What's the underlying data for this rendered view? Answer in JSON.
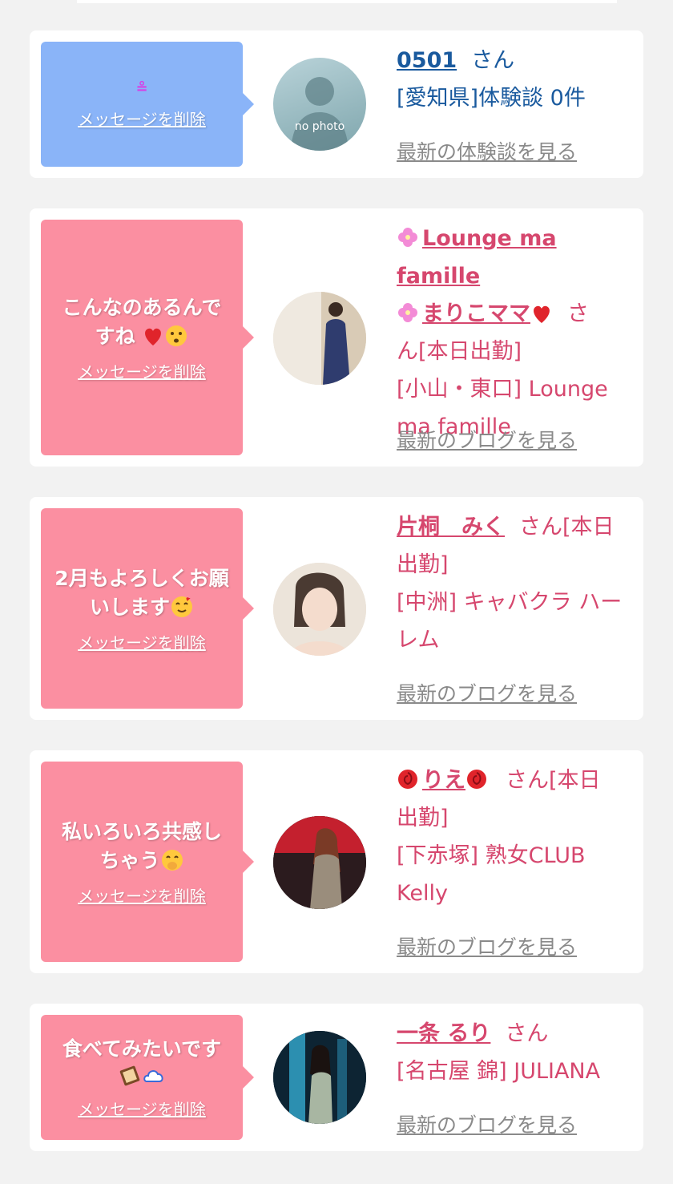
{
  "cards": [
    {
      "message": "≗",
      "delete_label": "メッセージを削除",
      "name": "0501",
      "suffix": "さん",
      "detail_line": "[愛知県]体験談 0件",
      "latest_link": "最新の体験談を見る",
      "avatar_text": "no photo"
    },
    {
      "message_line1": "こんなのあるんで",
      "message_line2": "すね",
      "delete_label": "メッセージを削除",
      "name_line1": "Lounge ma famille",
      "name_line2": "まりこママ",
      "suffix": "さ",
      "detail_line1": "ん[本日出勤]",
      "detail_line2": "[小山・東口] Lounge",
      "detail_line3": "ma famille",
      "latest_link": "最新のブログを見る"
    },
    {
      "message_line1": "2月もよろしくお願",
      "message_line2": "いします",
      "delete_label": "メッセージを削除",
      "name": "片桐　みく",
      "suffix": "さん[本日",
      "detail_line1": "出勤]",
      "detail_line2": "[中洲] キャバクラ ハー",
      "detail_line3": "レム",
      "latest_link": "最新のブログを見る"
    },
    {
      "message_line1": "私いろいろ共感し",
      "message_line2": "ちゃう",
      "delete_label": "メッセージを削除",
      "name": "りえ",
      "suffix": "さん[本日",
      "detail_line1": "出勤]",
      "detail_line2": "[下赤塚] 熟女CLUB",
      "detail_line3": "Kelly",
      "latest_link": "最新のブログを見る"
    },
    {
      "message_line1": "食べてみたいです",
      "delete_label": "メッセージを削除",
      "name": "一条 るり",
      "suffix": "さん",
      "detail_line1": "[名古屋 錦] JULIANA",
      "latest_link": "最新のブログを見る"
    }
  ],
  "colors": {
    "bubble_blue": "#8ab4f8",
    "bubble_pink": "#fb8fa1",
    "accent_pink": "#d6476e",
    "link_blue": "#1a5a9e",
    "muted_gray": "#8a8a8a"
  },
  "icons": [
    "flower-icon",
    "heart-icon",
    "emoji-icon",
    "rose-icon",
    "chocolate-icon",
    "cloud-icon"
  ]
}
